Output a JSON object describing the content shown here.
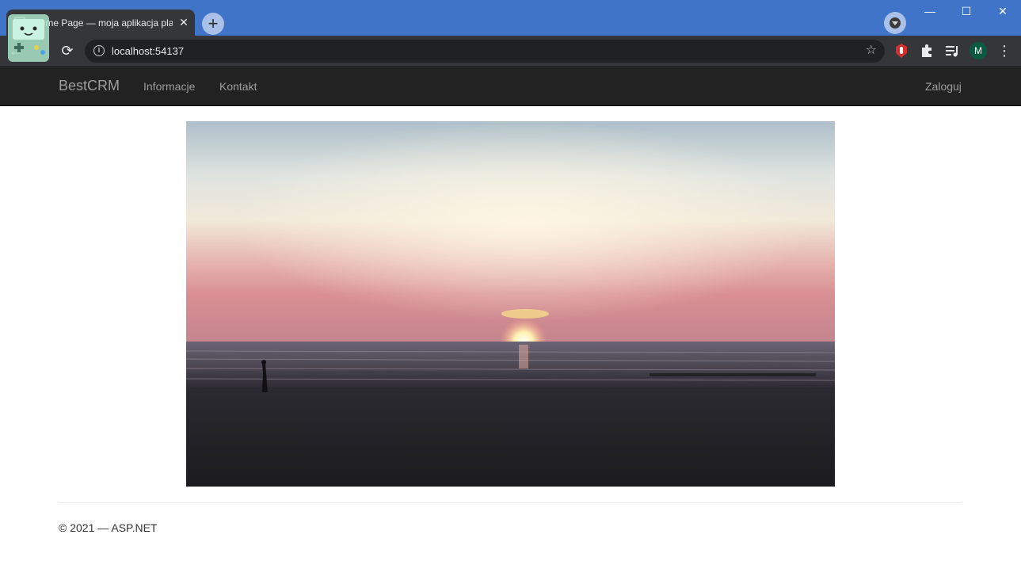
{
  "browser": {
    "tab": {
      "title": "Home Page — moja aplikacja pla",
      "close_label": "✕"
    },
    "new_tab_label": "+",
    "window_controls": {
      "minimize": "—",
      "maximize": "☐",
      "close": "✕"
    },
    "toolbar": {
      "back_icon": "←",
      "reload_icon": "⟳",
      "url": "localhost:54137",
      "info_icon": "i",
      "star_icon": "☆",
      "extensions": [
        "adblock-hand-icon",
        "puzzle-icon",
        "media-queue-icon"
      ],
      "profile_initial": "M",
      "menu_icon": "⋮"
    },
    "theme_color": "#3f74c9"
  },
  "site": {
    "brand": "BestCRM",
    "nav": [
      {
        "label": "Informacje"
      },
      {
        "label": "Kontakt"
      }
    ],
    "login_label": "Zaloguj",
    "hero_image": "sunset-over-sea-beach-photo",
    "footer": "© 2021 — ASP.NET"
  }
}
